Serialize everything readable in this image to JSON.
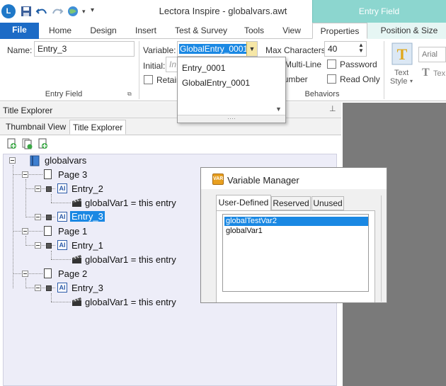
{
  "window": {
    "title": "Lectora Inspire - globalvars.awt",
    "context_group": "Entry Field"
  },
  "ribbon_tabs": [
    "File",
    "Home",
    "Design",
    "Insert",
    "Test & Survey",
    "Tools",
    "View",
    "Properties",
    "Position & Size"
  ],
  "ribbon": {
    "name_label": "Name:",
    "name_value": "Entry_3",
    "variable_label": "Variable:",
    "variable_value": "GlobalEntry_0001",
    "max_chars_label": "Max Characters:",
    "max_chars_value": "40",
    "initial_label": "Initial:",
    "initial_placeholder": "In",
    "retain_label": "Retain",
    "multiline_label": "Multi-Line",
    "password_label": "Password",
    "number_label": "Number",
    "readonly_label": "Read Only",
    "group_entry_field": "Entry Field",
    "group_behaviors": "Behaviors",
    "text_style_label": "Text",
    "text_style_label2": "Style",
    "font_value": "Arial",
    "text_cut": "Tex"
  },
  "variable_dropdown": {
    "options": [
      "Entry_0001",
      "GlobalEntry_0001"
    ]
  },
  "explorer": {
    "title": "Title Explorer",
    "tabs": [
      "Thumbnail View",
      "Title Explorer"
    ],
    "tree": {
      "root": "globalvars",
      "page3": "Page 3",
      "entry2": "Entry_2",
      "action_a": "globalVar1 = this entry",
      "entry3": "Entry_3",
      "page1": "Page 1",
      "entry1": "Entry_1",
      "action_b": "globalVar1 = this entry",
      "page2": "Page 2",
      "entry3b": "Entry_3",
      "action_c": "globalVar1 = this entry"
    }
  },
  "variable_manager": {
    "title": "Variable Manager",
    "tabs": [
      "User-Defined",
      "Reserved",
      "Unused"
    ],
    "items": [
      "globalTestVar2",
      "globalVar1"
    ]
  },
  "colors": {
    "accent": "#1c6bc6",
    "context": "#8cd6cf",
    "selection": "#1a88e3"
  }
}
